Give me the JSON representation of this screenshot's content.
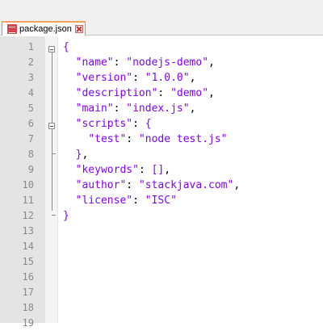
{
  "tab": {
    "label": "package.json",
    "file_icon": "file-modified-icon",
    "close_icon": "close-icon",
    "accent_color": "#f2a25e"
  },
  "editor": {
    "lines": [
      {
        "n": "1",
        "text": "{"
      },
      {
        "n": "2",
        "text": "  \"name\": \"nodejs-demo\","
      },
      {
        "n": "3",
        "text": "  \"version\": \"1.0.0\","
      },
      {
        "n": "4",
        "text": "  \"description\": \"demo\","
      },
      {
        "n": "5",
        "text": "  \"main\": \"index.js\","
      },
      {
        "n": "6",
        "text": "  \"scripts\": {"
      },
      {
        "n": "7",
        "text": "    \"test\": \"node test.js\""
      },
      {
        "n": "8",
        "text": "  },"
      },
      {
        "n": "9",
        "text": "  \"keywords\": [],"
      },
      {
        "n": "10",
        "text": "  \"author\": \"stackjava.com\","
      },
      {
        "n": "11",
        "text": "  \"license\": \"ISC\""
      },
      {
        "n": "12",
        "text": "}"
      },
      {
        "n": "13",
        "text": ""
      },
      {
        "n": "14",
        "text": ""
      },
      {
        "n": "15",
        "text": ""
      },
      {
        "n": "16",
        "text": ""
      },
      {
        "n": "17",
        "text": ""
      },
      {
        "n": "18",
        "text": ""
      },
      {
        "n": "19",
        "text": ""
      }
    ]
  }
}
